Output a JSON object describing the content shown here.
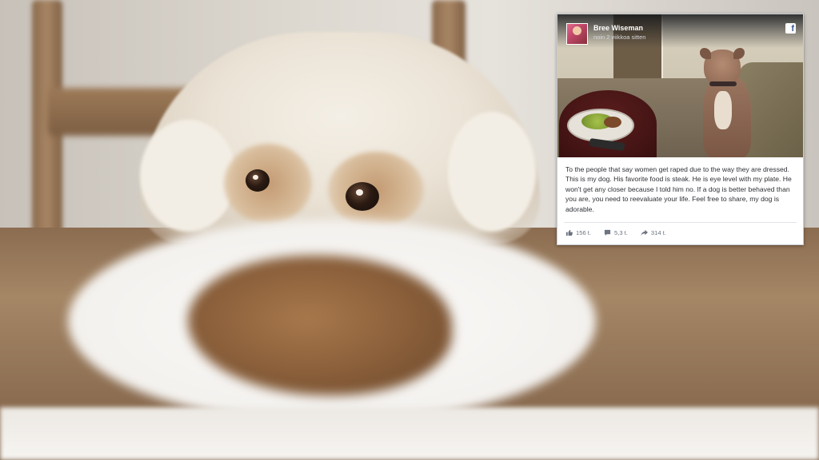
{
  "post": {
    "author": "Bree Wiseman",
    "time": "noin 2 viikkoa sitten",
    "platform_logo": "f",
    "text": "To the people that say women get raped due to the way they are dressed. This is my dog. His favorite food is steak. He is eye level with my plate. He won't get any closer because I told him no. If a dog is better behaved than you are, you need to reevaluate your life. Feel free to share, my dog is adorable.",
    "likes": "156 t.",
    "comments": "5,3 t.",
    "shares": "314 t."
  },
  "icons": {
    "like": "thumbs-up-icon",
    "comment": "comment-icon",
    "share": "share-arrow-icon",
    "facebook": "facebook-logo-icon"
  },
  "colors": {
    "facebook_blue": "#3b5998",
    "card_header": "#3a3f46"
  }
}
